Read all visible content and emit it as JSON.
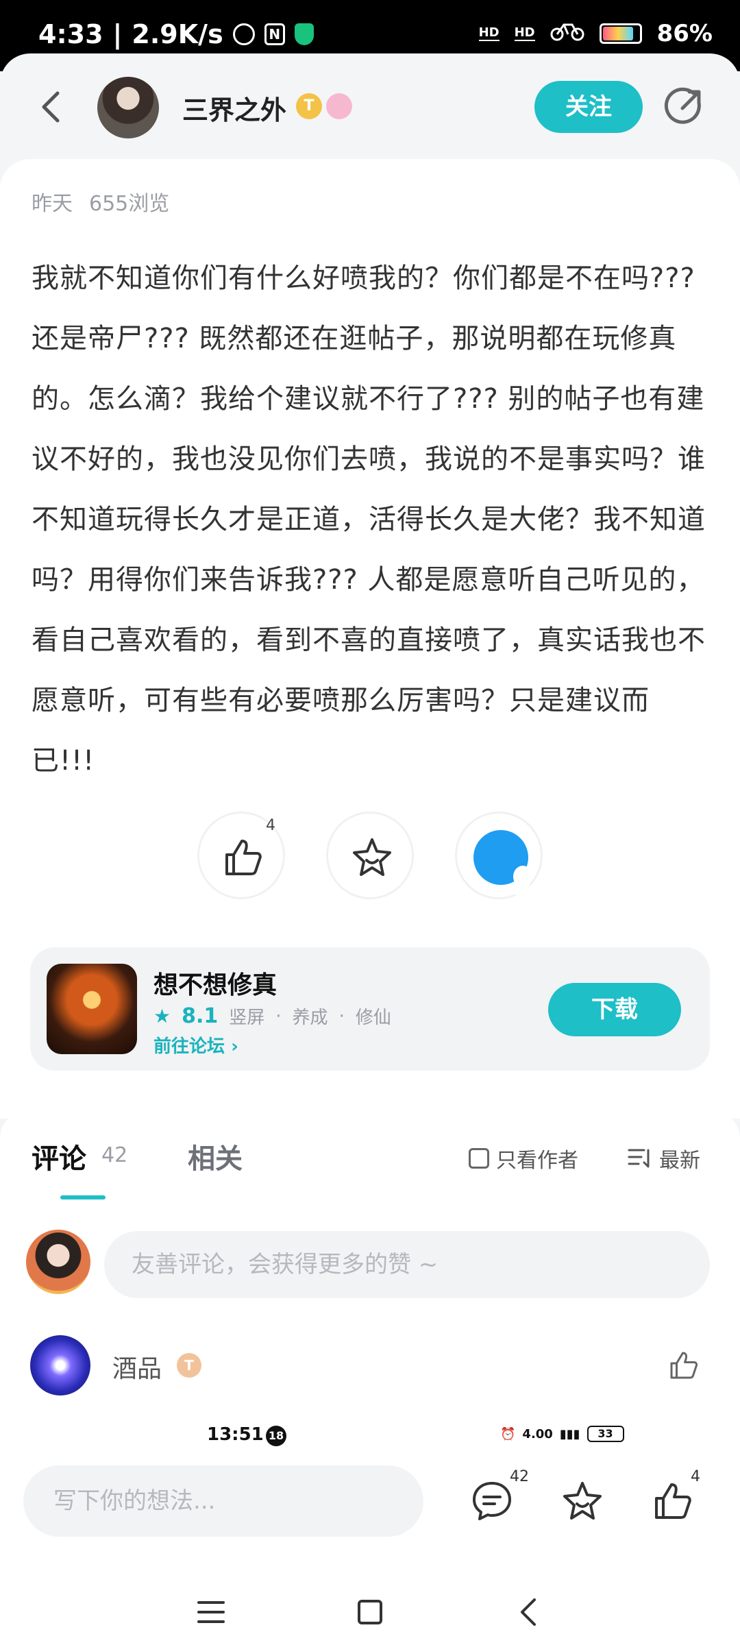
{
  "status_bar": {
    "time": "4:33",
    "speed": "2.9K/s",
    "hd1": "HD",
    "hd2": "HD",
    "battery": "86%",
    "battery_level": 0.86
  },
  "header": {
    "author_name": "三界之外",
    "badge_t": "T",
    "follow_label": "关注"
  },
  "post": {
    "date": "昨天",
    "views": "655浏览",
    "body": "我就不知道你们有什么好喷我的？你们都是不在吗??? 还是帝尸??? 既然都还在逛帖子，那说明都在玩修真的。怎么滴？我给个建议就不行了??? 别的帖子也有建议不好的，我也没见你们去喷，我说的不是事实吗？谁不知道玩得长久才是正道，活得长久是大佬？我不知道吗？用得你们来告诉我??? 人都是愿意听自己听见的，看自己喜欢看的，看到不喜的直接喷了，真实话我也不愿意听，可有些有必要喷那么厉害吗？只是建议而已!!!",
    "like_count": "4"
  },
  "game": {
    "title": "想不想修真",
    "score": "8.1",
    "tags": [
      "竖屏",
      "养成",
      "修仙"
    ],
    "separator": "·",
    "forum_link": "前往论坛",
    "download_label": "下载"
  },
  "comments": {
    "tab_comment": "评论",
    "comment_count": "42",
    "tab_related": "相关",
    "only_author": "只看作者",
    "sort_label": "最新",
    "input_placeholder": "友善评论，会获得更多的赞 ~",
    "first_commenter": "酒品",
    "first_commenter_badge": "T"
  },
  "peek": {
    "time": "13:51",
    "age": "18",
    "speed": "4.00",
    "batt": "33"
  },
  "bottom_bar": {
    "input_placeholder": "写下你的想法...",
    "comment_count": "42",
    "like_count": "4"
  },
  "colors": {
    "accent": "#1ebfc7",
    "qq_blue": "#1e9df1"
  }
}
